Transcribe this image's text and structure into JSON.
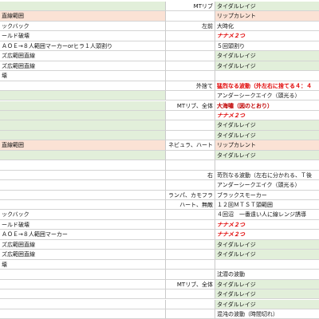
{
  "colors": {
    "green": "#e2efda",
    "salmon": "#fbe2d5",
    "white": "#ffffff",
    "red": "#e00000",
    "grid": "#d4d4d4"
  },
  "rows": [
    {
      "a": "",
      "a_fill": "green",
      "b": "MTリブ",
      "c": "タイダルレイジ",
      "c_fill": "green",
      "c_style": ""
    },
    {
      "a": "直線範囲",
      "a_fill": "salmon",
      "b": "",
      "c": "リップカレント",
      "c_fill": "salmon",
      "c_style": ""
    },
    {
      "a": "ックバック",
      "a_fill": "white",
      "b": "左前",
      "c": "大時化",
      "c_fill": "white",
      "c_style": ""
    },
    {
      "a": "ールド破壊",
      "a_fill": "white",
      "b": "",
      "c": "ナナメ２つ",
      "c_fill": "white",
      "c_style": "red-italic"
    },
    {
      "a": "ＡＯＥ→８人範囲マーカーorヒラ１人頭割り",
      "a_fill": "white",
      "b": "",
      "c": "５回頭割り",
      "c_fill": "white",
      "c_style": ""
    },
    {
      "a": "ズ広範囲直線",
      "a_fill": "white",
      "b": "",
      "c": "タイダルレイジ",
      "c_fill": "green",
      "c_style": ""
    },
    {
      "a": "ズ広範囲直線",
      "a_fill": "white",
      "b": "",
      "c": "タイダルレイジ",
      "c_fill": "green",
      "c_style": ""
    },
    {
      "a": "壊",
      "a_fill": "white",
      "b": "",
      "c": "",
      "c_fill": "white",
      "c_style": ""
    },
    {
      "a": "",
      "a_fill": "white",
      "b": "外捨て",
      "c": "猛烈なる波動（外左右に捨てる４：４",
      "c_fill": "white",
      "c_style": "red"
    },
    {
      "a": "",
      "a_fill": "green",
      "b": "",
      "c": "アンダーシークエイク（頭光る）",
      "c_fill": "white",
      "c_style": ""
    },
    {
      "a": "",
      "a_fill": "green",
      "b": "MTリブ、全体",
      "c": "大海嘯（図のとおり）",
      "c_fill": "white",
      "c_style": "darkred"
    },
    {
      "a": "",
      "a_fill": "green",
      "b": "",
      "c": "ナナメ２つ",
      "c_fill": "white",
      "c_style": "red-italic"
    },
    {
      "a": "",
      "a_fill": "green",
      "b": "",
      "c": "タイダルレイジ",
      "c_fill": "green",
      "c_style": ""
    },
    {
      "a": "",
      "a_fill": "green",
      "b": "",
      "c": "タイダルレイジ",
      "c_fill": "green",
      "c_style": ""
    },
    {
      "a": "直線範囲",
      "a_fill": "salmon",
      "b": "ネビュラ、ハート",
      "c": "リップカレント",
      "c_fill": "salmon",
      "c_style": ""
    },
    {
      "a": "",
      "a_fill": "green",
      "b": "",
      "c": "タイダルレイジ",
      "c_fill": "green",
      "c_style": ""
    },
    {
      "a": "",
      "a_fill": "white",
      "b": "",
      "c": "",
      "c_fill": "white",
      "c_style": ""
    },
    {
      "a": "",
      "a_fill": "white",
      "b": "右",
      "c": "苛烈なる波動（左右に分かれる、Ｔ後",
      "c_fill": "white",
      "c_style": ""
    },
    {
      "a": "",
      "a_fill": "white",
      "b": "",
      "c": "アンダーシークエイク（頭光る）",
      "c_fill": "white",
      "c_style": ""
    },
    {
      "a": "",
      "a_fill": "white",
      "b": "ランパ、カモフラ",
      "c": "ブラックスモーカー",
      "c_fill": "white",
      "c_style": ""
    },
    {
      "a": "",
      "a_fill": "white",
      "b": "ハート、無敵",
      "c": "１２回ＭＴＳＴ頭範囲",
      "c_fill": "white",
      "c_style": ""
    },
    {
      "a": "ックバック",
      "a_fill": "white",
      "b": "",
      "c": "４回沼　一番遠い人に線レンジ誘導",
      "c_fill": "white",
      "c_style": ""
    },
    {
      "a": "ールド破壊",
      "a_fill": "white",
      "b": "",
      "c": "ナナメ２つ",
      "c_fill": "white",
      "c_style": "red-italic"
    },
    {
      "a": "ＡＯＥ→８人範囲マーカー",
      "a_fill": "white",
      "b": "",
      "c": "ナナメ２つ",
      "c_fill": "white",
      "c_style": "red-italic"
    },
    {
      "a": "ズ広範囲直線",
      "a_fill": "white",
      "b": "",
      "c": "タイダルレイジ",
      "c_fill": "green",
      "c_style": ""
    },
    {
      "a": "ズ広範囲直線",
      "a_fill": "white",
      "b": "",
      "c": "タイダルレイジ",
      "c_fill": "green",
      "c_style": ""
    },
    {
      "a": "壊",
      "a_fill": "white",
      "b": "",
      "c": "",
      "c_fill": "white",
      "c_style": ""
    },
    {
      "a": "",
      "a_fill": "white",
      "b": "",
      "c": "沈潜の波動",
      "c_fill": "white",
      "c_style": ""
    },
    {
      "a": "",
      "a_fill": "white",
      "b": "MTリブ、全体",
      "c": "タイダルレイジ",
      "c_fill": "green",
      "c_style": ""
    },
    {
      "a": "",
      "a_fill": "white",
      "b": "",
      "c": "タイダルレイジ",
      "c_fill": "green",
      "c_style": ""
    },
    {
      "a": "",
      "a_fill": "white",
      "b": "",
      "c": "タイダルレイジ",
      "c_fill": "green",
      "c_style": ""
    },
    {
      "a": "",
      "a_fill": "white",
      "b": "",
      "c": "混沌の波動（時間切れ）",
      "c_fill": "white",
      "c_style": ""
    }
  ]
}
